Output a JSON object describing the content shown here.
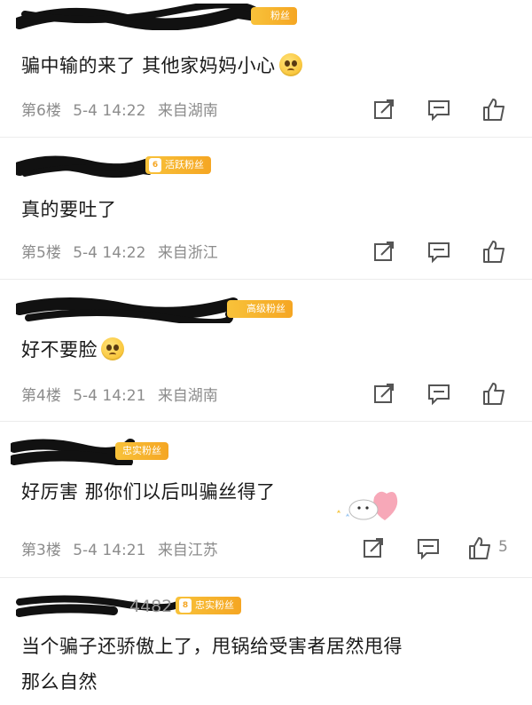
{
  "icons": {
    "share": "share-icon",
    "comment": "comment-icon",
    "like": "like-icon",
    "emoji": "pleading-face-emoji",
    "sticker": "cartoon-sticker"
  },
  "colors": {
    "badge": "#f5a623",
    "meta_text": "#8c8c8c",
    "icon_stroke": "#555555"
  },
  "comments": [
    {
      "username_visible": "",
      "badge": "粉丝",
      "badge_level": "",
      "text": "骗中输的来了 其他家妈妈小心",
      "has_emoji": true,
      "floor": "第6楼",
      "date": "5-4 14:22",
      "location": "来自湖南",
      "like_count": ""
    },
    {
      "username_visible": "",
      "badge": "活跃粉丝",
      "badge_level": "6",
      "text": "真的要吐了",
      "has_emoji": false,
      "floor": "第5楼",
      "date": "5-4 14:22",
      "location": "来自浙江",
      "like_count": ""
    },
    {
      "username_visible": "",
      "badge": "高级粉丝",
      "badge_level": "",
      "text": "好不要脸",
      "has_emoji": true,
      "floor": "第4楼",
      "date": "5-4 14:21",
      "location": "来自湖南",
      "like_count": ""
    },
    {
      "username_visible": "",
      "badge": "忠实粉丝",
      "badge_level": "",
      "text": "好厉害 那你们以后叫骗丝得了",
      "has_emoji": false,
      "floor": "第3楼",
      "date": "5-4 14:21",
      "location": "来自江苏",
      "like_count": "5"
    },
    {
      "username_visible": "4482",
      "badge": "忠实粉丝",
      "badge_level": "8",
      "text_line1": "当个骗子还骄傲上了，甩锅给受害者居然甩得",
      "text_line2": "那么自然"
    }
  ]
}
